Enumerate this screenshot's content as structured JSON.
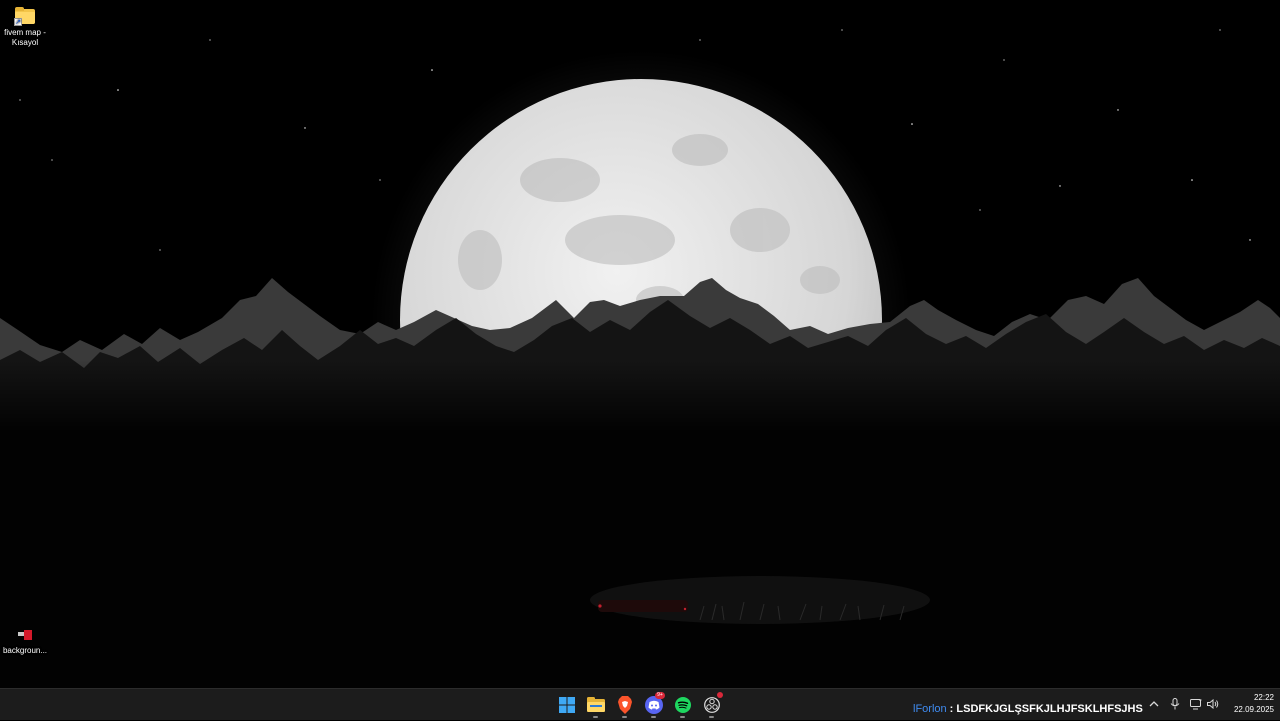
{
  "desktop": {
    "icons": [
      {
        "label": "fivem map - Kısayol",
        "icon": "folder-shortcut-icon"
      },
      {
        "label": "backgroun...",
        "icon": "image-file-icon"
      }
    ]
  },
  "taskbar": {
    "apps": [
      {
        "name": "Start",
        "icon": "windows-start-icon",
        "color": "#3fa9f5"
      },
      {
        "name": "File Explorer",
        "icon": "file-explorer-icon",
        "color": "#f3c54a"
      },
      {
        "name": "Brave",
        "icon": "brave-browser-icon",
        "color": "#fb542b"
      },
      {
        "name": "Discord",
        "icon": "discord-icon",
        "color": "#5865f2",
        "badge": "9+"
      },
      {
        "name": "Spotify",
        "icon": "spotify-icon",
        "color": "#1ed760"
      },
      {
        "name": "OBS Studio",
        "icon": "obs-icon",
        "color": "#e0e0e0",
        "badge": ""
      }
    ],
    "now_playing": {
      "user": "lForlon",
      "separator": " : ",
      "text": "LSDFKJGLŞSFKJLHJFSKLHFSJHS"
    },
    "tray": {
      "icons": [
        "chevron-up-icon",
        "microphone-icon",
        "display-icon",
        "speaker-icon"
      ]
    },
    "clock": {
      "time": "22:22",
      "date": "22.09.2025"
    }
  }
}
